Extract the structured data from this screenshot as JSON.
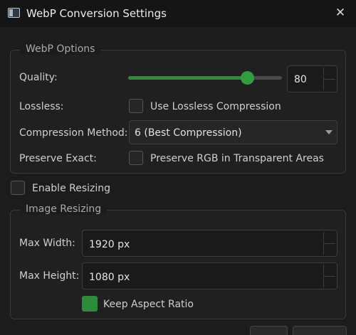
{
  "window": {
    "title": "WebP Conversion Settings",
    "icon": "app-window-icon",
    "close_icon": "close-icon",
    "close_glyph": "✕"
  },
  "webp_options": {
    "group_title": "WebP Options",
    "quality": {
      "label": "Quality:",
      "slider_value": 80,
      "spin_value": "80",
      "accent": "#2e8b3a"
    },
    "lossless": {
      "label": "Lossless:",
      "checkbox_label": "Use Lossless Compression",
      "checked": false
    },
    "compression": {
      "label": "Compression Method:",
      "selected": "6 (Best Compression)"
    },
    "preserve_exact": {
      "label": "Preserve Exact:",
      "checkbox_label": "Preserve RGB in Transparent Areas",
      "checked": false
    }
  },
  "enable_resizing": {
    "label": "Enable Resizing",
    "checked": false
  },
  "image_resizing": {
    "group_title": "Image Resizing",
    "max_width": {
      "label": "Max Width:",
      "value": "1920 px"
    },
    "max_height": {
      "label": "Max Height:",
      "value": "1080 px"
    },
    "keep_aspect": {
      "label": "Keep Aspect Ratio",
      "checked": true
    }
  }
}
